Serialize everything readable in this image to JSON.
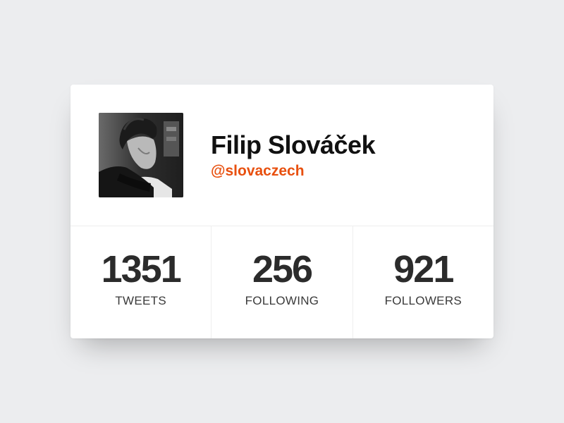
{
  "profile": {
    "name": "Filip Slováček",
    "handle": "@slovaczech",
    "avatar_icon": "profile-photo"
  },
  "stats": [
    {
      "value": "1351",
      "label": "TWEETS"
    },
    {
      "value": "256",
      "label": "FOLLOWING"
    },
    {
      "value": "921",
      "label": "FOLLOWERS"
    }
  ],
  "colors": {
    "accent": "#e8500f",
    "background": "#ecedef",
    "card": "#ffffff",
    "text": "#111111"
  }
}
